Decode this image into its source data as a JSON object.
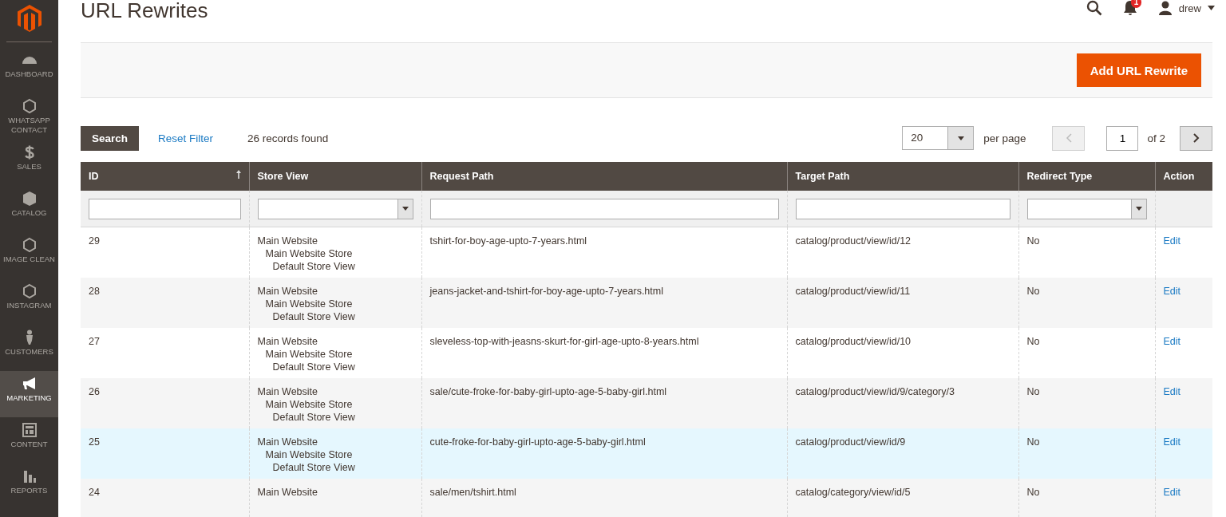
{
  "sidebar": {
    "items": [
      {
        "label": "DASHBOARD",
        "selected": false
      },
      {
        "label": "WHATSAPP CONTACT",
        "selected": false
      },
      {
        "label": "SALES",
        "selected": false
      },
      {
        "label": "CATALOG",
        "selected": false
      },
      {
        "label": "IMAGE CLEAN",
        "selected": false
      },
      {
        "label": "INSTAGRAM",
        "selected": false
      },
      {
        "label": "CUSTOMERS",
        "selected": false
      },
      {
        "label": "MARKETING",
        "selected": true
      },
      {
        "label": "CONTENT",
        "selected": false
      },
      {
        "label": "REPORTS",
        "selected": false
      }
    ]
  },
  "page_title": "URL Rewrites",
  "header": {
    "notifications": "1",
    "user": "drew"
  },
  "primary_button": "Add URL Rewrite",
  "toolbar": {
    "search_button": "Search",
    "reset_link": "Reset Filter",
    "records": "26 records found",
    "per_page_value": "20",
    "per_page_label": "per page",
    "page": "1",
    "page_total": "of 2"
  },
  "table": {
    "columns": [
      {
        "label": "ID",
        "sorted": true
      },
      {
        "label": "Store View",
        "sorted": false
      },
      {
        "label": "Request Path",
        "sorted": false
      },
      {
        "label": "Target Path",
        "sorted": false
      },
      {
        "label": "Redirect Type",
        "sorted": false
      },
      {
        "label": "Action",
        "sorted": false
      }
    ],
    "rows": [
      {
        "id": "29",
        "website": "Main Website",
        "store": "Main Website Store",
        "view": "Default Store View",
        "request_path": "tshirt-for-boy-age-upto-7-years.html",
        "target_path": "catalog/product/view/id/12",
        "redirect_type": "No",
        "action": "Edit",
        "highlighted": false
      },
      {
        "id": "28",
        "website": "Main Website",
        "store": "Main Website Store",
        "view": "Default Store View",
        "request_path": "jeans-jacket-and-tshirt-for-boy-age-upto-7-years.html",
        "target_path": "catalog/product/view/id/11",
        "redirect_type": "No",
        "action": "Edit",
        "highlighted": false
      },
      {
        "id": "27",
        "website": "Main Website",
        "store": "Main Website Store",
        "view": "Default Store View",
        "request_path": "sleveless-top-with-jeasns-skurt-for-girl-age-upto-8-years.html",
        "target_path": "catalog/product/view/id/10",
        "redirect_type": "No",
        "action": "Edit",
        "highlighted": false
      },
      {
        "id": "26",
        "website": "Main Website",
        "store": "Main Website Store",
        "view": "Default Store View",
        "request_path": "sale/cute-froke-for-baby-girl-upto-age-5-baby-girl.html",
        "target_path": "catalog/product/view/id/9/category/3",
        "redirect_type": "No",
        "action": "Edit",
        "highlighted": false
      },
      {
        "id": "25",
        "website": "Main Website",
        "store": "Main Website Store",
        "view": "Default Store View",
        "request_path": "cute-froke-for-baby-girl-upto-age-5-baby-girl.html",
        "target_path": "catalog/product/view/id/9",
        "redirect_type": "No",
        "action": "Edit",
        "highlighted": true
      },
      {
        "id": "24",
        "website": "Main Website",
        "request_path": "sale/men/tshirt.html",
        "target_path": "catalog/category/view/id/5",
        "redirect_type": "No",
        "action": "Edit",
        "highlighted": false
      }
    ]
  }
}
